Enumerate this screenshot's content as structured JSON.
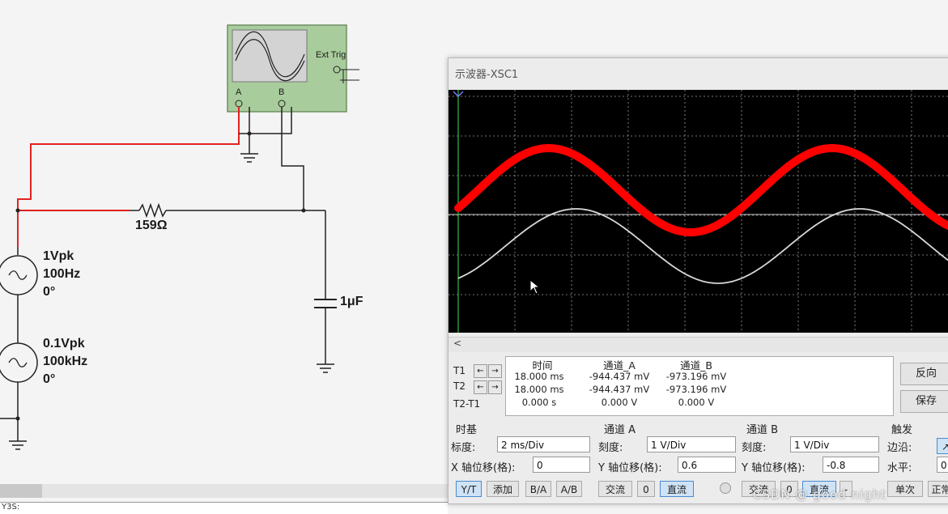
{
  "schematic": {
    "resistor_label": "159Ω",
    "capacitor_label": "1μF",
    "source1": {
      "amplitude": "1Vpk",
      "frequency": "100Hz",
      "phase": "0°"
    },
    "source2": {
      "amplitude": "0.1Vpk",
      "frequency": "100kHz",
      "phase": "0°"
    },
    "scope_symbol": {
      "ext_trig": "Ext Trig",
      "pin_a": "A",
      "pin_b": "B",
      "minus": "_"
    }
  },
  "scope_window": {
    "title": "示波器-XSC1",
    "scroll_left": "<",
    "channel_a_color": "#ff0000",
    "channel_b_color": "#d8d8d8",
    "cursors": {
      "t1": "T1",
      "t2": "T2",
      "t2t1": "T2-T1",
      "headers": {
        "time": "时间",
        "ch_a": "通道_A",
        "ch_b": "通道_B"
      },
      "row_t1": {
        "time": "18.000 ms",
        "ch_a": "-944.437 mV",
        "ch_b": "-973.196 mV"
      },
      "row_t2": {
        "time": "18.000 ms",
        "ch_a": "-944.437 mV",
        "ch_b": "-973.196 mV"
      },
      "row_diff": {
        "time": "0.000 s",
        "ch_a": "0.000 V",
        "ch_b": "0.000 V"
      },
      "left_arrow": "←",
      "right_arrow": "→"
    },
    "side_buttons": {
      "reverse": "反向",
      "save": "保存"
    },
    "timebase": {
      "title": "时基",
      "scale_label": "标度:",
      "scale_value": "2 ms/Div",
      "xpos_label": "X 轴位移(格):",
      "xpos_value": "0",
      "buttons": [
        "Y/T",
        "添加",
        "B/A",
        "A/B"
      ]
    },
    "channel_a": {
      "title": "通道 A",
      "scale_label": "刻度:",
      "scale_value": "1  V/Div",
      "ypos_label": "Y 轴位移(格):",
      "ypos_value": "0.6",
      "buttons": [
        "交流",
        "0",
        "直流"
      ]
    },
    "channel_b": {
      "title": "通道 B",
      "scale_label": "刻度:",
      "scale_value": "1  V/Div",
      "ypos_label": "Y 轴位移(格):",
      "ypos_value": "-0.8",
      "buttons": [
        "交流",
        "0",
        "直流",
        "-"
      ]
    },
    "trigger": {
      "title": "触发",
      "edge_label": "边沿:",
      "level_label": "水平:",
      "level_value": "0",
      "buttons": [
        "单次",
        "正常"
      ]
    }
  },
  "watermark": "CSDN @ good night",
  "status": {
    "left": "Y3S:"
  }
}
